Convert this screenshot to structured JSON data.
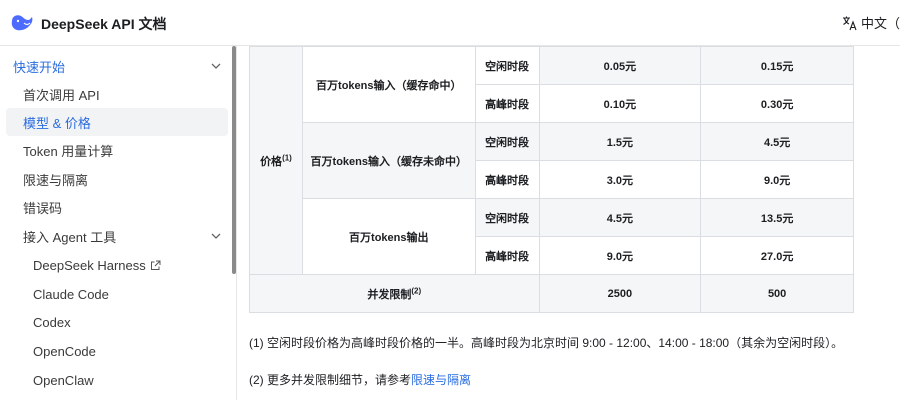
{
  "header": {
    "logo_icon": "whale-logo-icon",
    "brand": "DeepSeek API 文档",
    "language_icon": "translate-icon",
    "language": "中文（中"
  },
  "sidebar": {
    "items": [
      {
        "label": "快速开始",
        "state": "section-expanded"
      },
      {
        "label": "首次调用 API"
      },
      {
        "label": "模型 & 价格",
        "state": "active"
      },
      {
        "label": "Token 用量计算"
      },
      {
        "label": "限速与隔离"
      },
      {
        "label": "错误码"
      },
      {
        "label": "接入 Agent 工具",
        "state": "expanded"
      },
      {
        "label": "DeepSeek Harness",
        "icon": "external-link-icon"
      },
      {
        "label": "Claude Code"
      },
      {
        "label": "Codex"
      },
      {
        "label": "OpenCode"
      },
      {
        "label": "OpenClaw"
      }
    ]
  },
  "pricing_table": {
    "group_label": "价格",
    "group_sup": "(1)",
    "rows": [
      {
        "name": "百万tokens输入（缓存命中）",
        "sub": [
          {
            "period": "空闲时段",
            "a": "0.05元",
            "b": "0.15元"
          },
          {
            "period": "高峰时段",
            "a": "0.10元",
            "b": "0.30元"
          }
        ]
      },
      {
        "name": "百万tokens输入（缓存未命中）",
        "sub": [
          {
            "period": "空闲时段",
            "a": "1.5元",
            "b": "4.5元"
          },
          {
            "period": "高峰时段",
            "a": "3.0元",
            "b": "9.0元"
          }
        ]
      },
      {
        "name": "百万tokens输出",
        "sub": [
          {
            "period": "空闲时段",
            "a": "4.5元",
            "b": "13.5元"
          },
          {
            "period": "高峰时段",
            "a": "9.0元",
            "b": "27.0元"
          }
        ]
      }
    ],
    "concurrency": {
      "label": "并发限制",
      "sup": "(2)",
      "a": "2500",
      "b": "500"
    }
  },
  "notes": {
    "note1": "(1) 空闲时段价格为高峰时段价格的一半。高峰时段为北京时间 9:00 - 12:00、14:00 - 18:00（其余为空闲时段）。",
    "note2_prefix": "(2) 更多并发限制细节，请参考",
    "note2_link": "限速与隔离"
  },
  "colors": {
    "accent": "#2a6ce0",
    "active_bg": "#f2f3f5",
    "cell_alt_bg": "#f5f6f7",
    "border": "#dadde1"
  }
}
